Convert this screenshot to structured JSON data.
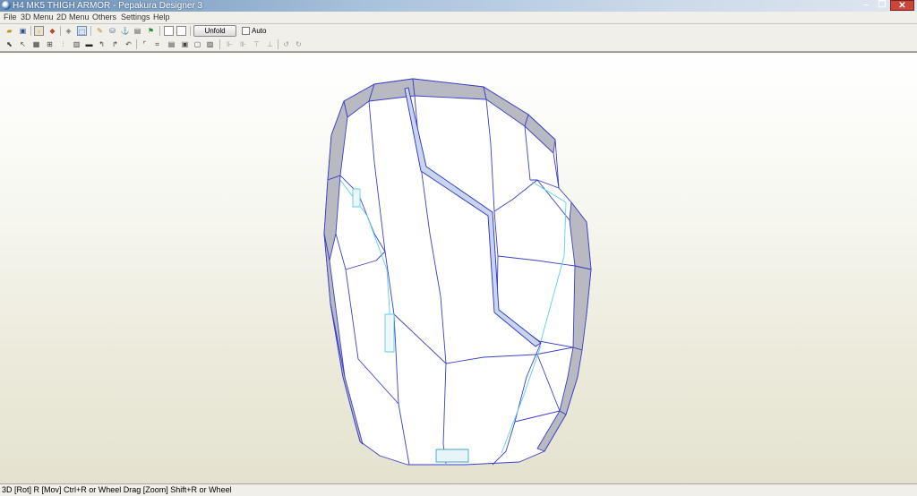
{
  "window": {
    "title": "H4 MK5 THIGH ARMOR - Pepakura Designer 3"
  },
  "menu": [
    "File",
    "3D Menu",
    "2D Menu",
    "Others",
    "Settings",
    "Help"
  ],
  "toolbar1": {
    "icons": [
      "open-icon",
      "save-icon",
      "lightbulb-icon",
      "color-cube-icon",
      "texture-icon",
      "select-view-icon",
      "pencil-icon",
      "cylinder-icon",
      "anchor-icon",
      "print-icon",
      "green-flag-icon",
      "single-view-icon",
      "split-view-icon"
    ],
    "unfold_label": "Unfold",
    "auto_label": "Auto"
  },
  "toolbar2": {
    "icons": [
      "select-icon",
      "move-edge-icon",
      "grid-icon",
      "join-icon",
      "edge-icon",
      "page-icon",
      "fold-icon",
      "rotate-left-icon",
      "rotate-right-icon",
      "snap-icon",
      "flap-icon",
      "mirror-icon",
      "align-left-icon",
      "align-center-icon",
      "align-right-icon",
      "undo-icon",
      "redo-icon"
    ]
  },
  "statusbar": {
    "text": "3D [Rot] R [Mov] Ctrl+R or Wheel Drag [Zoom] Shift+R or Wheel"
  },
  "colors": {
    "edge": "#3b3fc8",
    "cut_edge": "#5ad0e8",
    "face": "#ffffff",
    "side": "#b8b8c0"
  }
}
